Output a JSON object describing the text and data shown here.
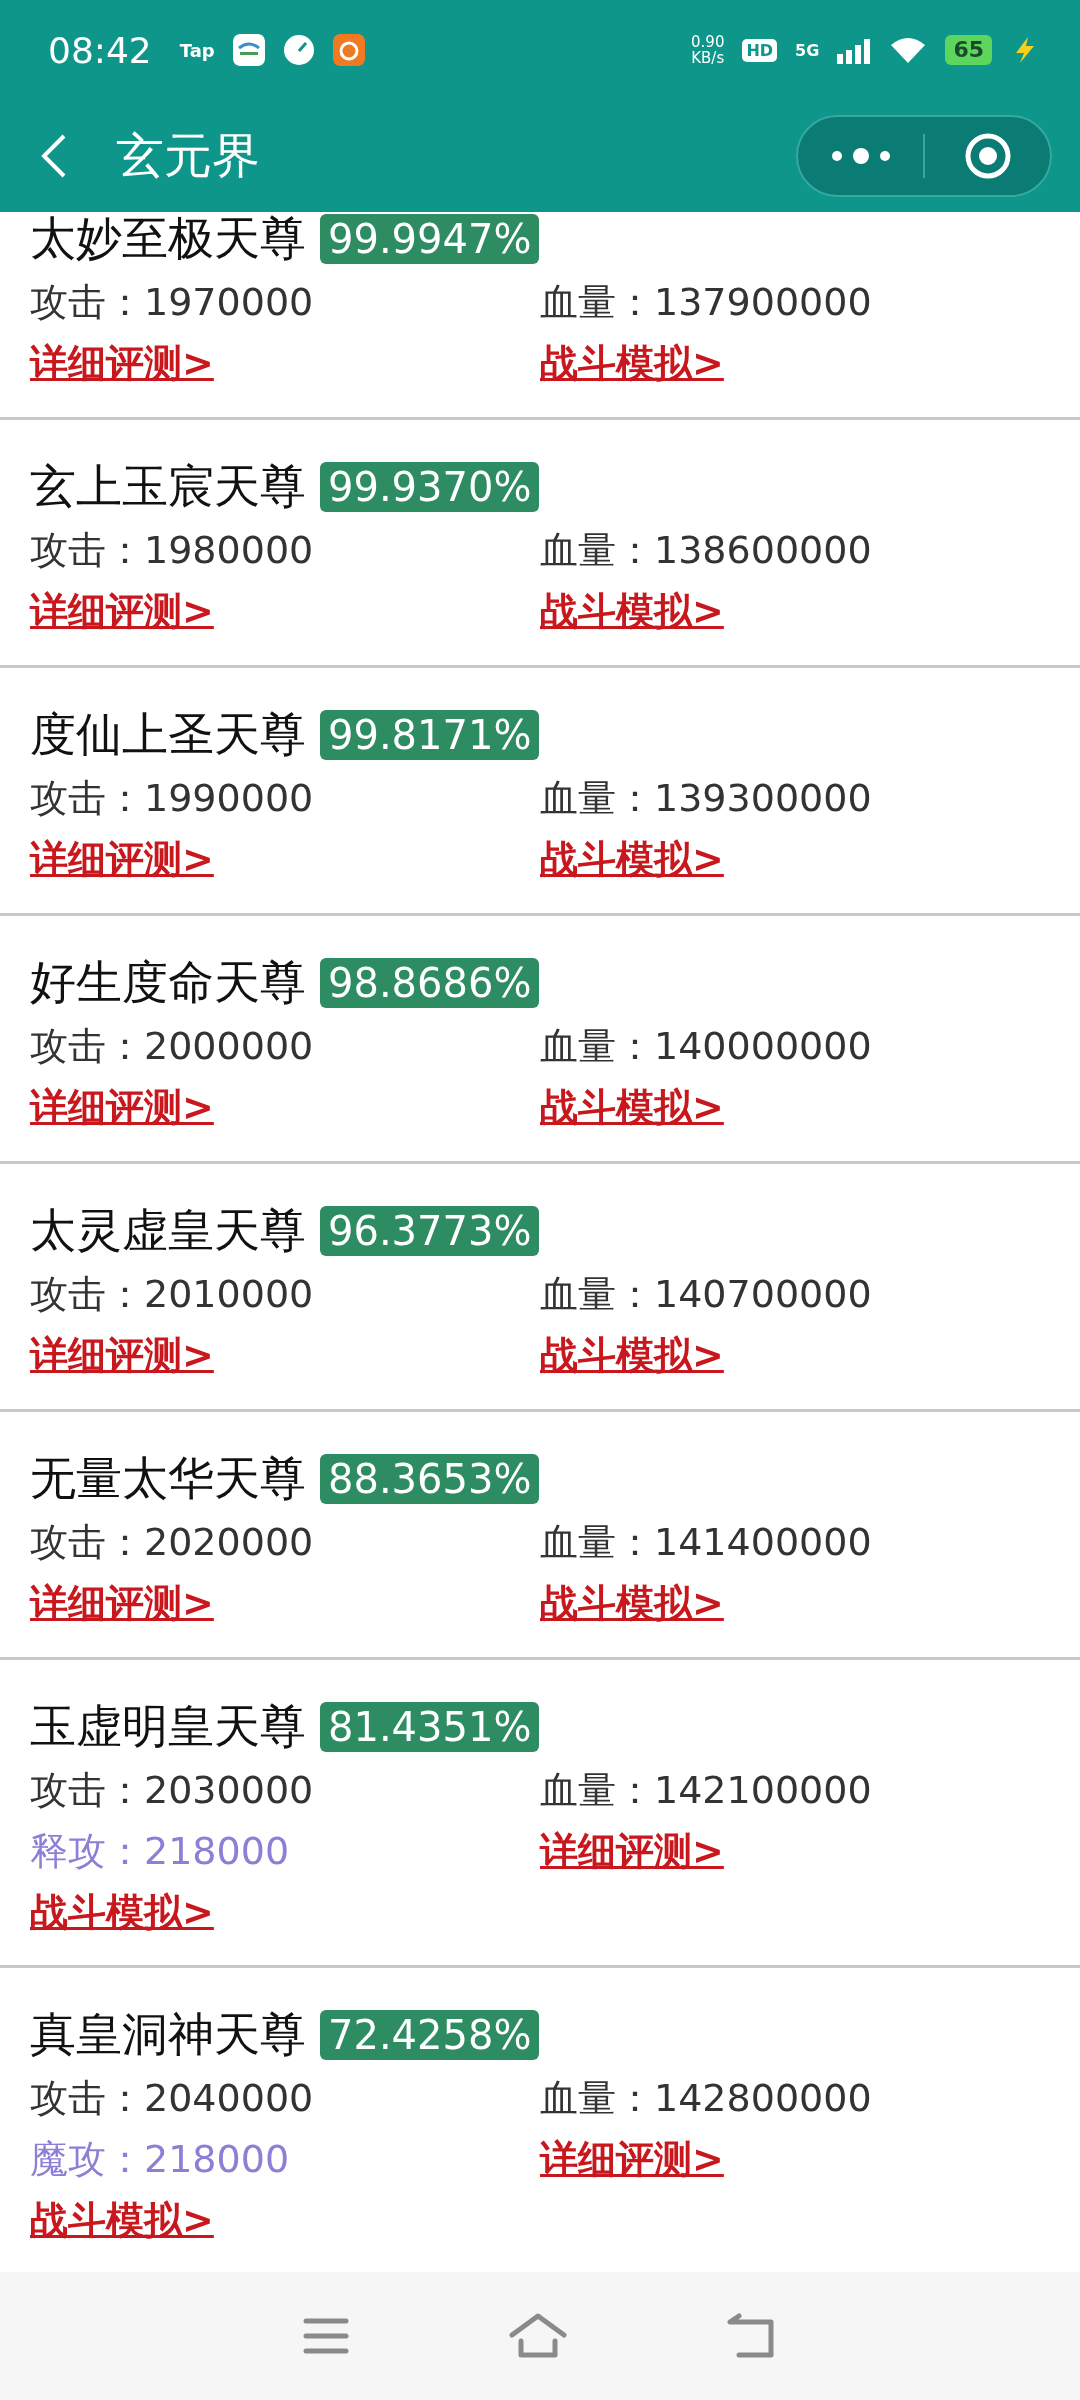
{
  "status_bar": {
    "time": "08:42",
    "app_label": "Tap",
    "speed": "0.90",
    "speed_unit": "KB/s",
    "hd": "HD",
    "network": "5G",
    "battery": "65"
  },
  "header": {
    "title": "玄元界"
  },
  "cards": [
    {
      "name": "太妙至极天尊",
      "percent": "99.9947%",
      "cells": [
        {
          "kind": "stat",
          "text": "攻击：1970000"
        },
        {
          "kind": "stat",
          "text": "血量：137900000"
        },
        {
          "kind": "link",
          "text": "详细评测>"
        },
        {
          "kind": "link",
          "text": "战斗模拟>"
        }
      ]
    },
    {
      "name": "玄上玉宸天尊",
      "percent": "99.9370%",
      "cells": [
        {
          "kind": "stat",
          "text": "攻击：1980000"
        },
        {
          "kind": "stat",
          "text": "血量：138600000"
        },
        {
          "kind": "link",
          "text": "详细评测>"
        },
        {
          "kind": "link",
          "text": "战斗模拟>"
        }
      ]
    },
    {
      "name": "度仙上圣天尊",
      "percent": "99.8171%",
      "cells": [
        {
          "kind": "stat",
          "text": "攻击：1990000"
        },
        {
          "kind": "stat",
          "text": "血量：139300000"
        },
        {
          "kind": "link",
          "text": "详细评测>"
        },
        {
          "kind": "link",
          "text": "战斗模拟>"
        }
      ]
    },
    {
      "name": "好生度命天尊",
      "percent": "98.8686%",
      "cells": [
        {
          "kind": "stat",
          "text": "攻击：2000000"
        },
        {
          "kind": "stat",
          "text": "血量：140000000"
        },
        {
          "kind": "link",
          "text": "详细评测>"
        },
        {
          "kind": "link",
          "text": "战斗模拟>"
        }
      ]
    },
    {
      "name": "太灵虚皇天尊",
      "percent": "96.3773%",
      "cells": [
        {
          "kind": "stat",
          "text": "攻击：2010000"
        },
        {
          "kind": "stat",
          "text": "血量：140700000"
        },
        {
          "kind": "link",
          "text": "详细评测>"
        },
        {
          "kind": "link",
          "text": "战斗模拟>"
        }
      ]
    },
    {
      "name": "无量太华天尊",
      "percent": "88.3653%",
      "cells": [
        {
          "kind": "stat",
          "text": "攻击：2020000"
        },
        {
          "kind": "stat",
          "text": "血量：141400000"
        },
        {
          "kind": "link",
          "text": "详细评测>"
        },
        {
          "kind": "link",
          "text": "战斗模拟>"
        }
      ]
    },
    {
      "name": "玉虚明皇天尊",
      "percent": "81.4351%",
      "cells": [
        {
          "kind": "stat",
          "text": "攻击：2030000"
        },
        {
          "kind": "stat",
          "text": "血量：142100000"
        },
        {
          "kind": "special",
          "text": "释攻：218000"
        },
        {
          "kind": "link",
          "text": "详细评测>"
        },
        {
          "kind": "link",
          "text": "战斗模拟>"
        }
      ]
    },
    {
      "name": "真皇洞神天尊",
      "percent": "72.4258%",
      "cells": [
        {
          "kind": "stat",
          "text": "攻击：2040000"
        },
        {
          "kind": "stat",
          "text": "血量：142800000"
        },
        {
          "kind": "special",
          "text": "魔攻：218000"
        },
        {
          "kind": "link",
          "text": "详细评测>"
        },
        {
          "kind": "link",
          "text": "战斗模拟>"
        }
      ]
    }
  ]
}
